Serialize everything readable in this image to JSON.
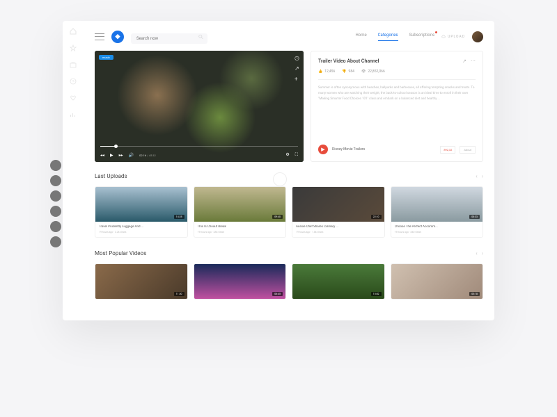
{
  "search": {
    "placeholder": "Search now"
  },
  "nav": {
    "home": "Home",
    "categories": "Categories",
    "subscriptions": "Subscriptions"
  },
  "upload": "UPLOAD",
  "player": {
    "tag": "music",
    "time": "02:16",
    "total": "/ 45:32"
  },
  "detail": {
    "title": "Trailer Video About Channel",
    "likes": "12,456",
    "dislikes": "984",
    "views": "22,852,066",
    "desc": "Summer is often synonymous with beaches, ballparks and barbecues, all offering tempting snacks and treats. To many women who are watching their weight, the back-to-school season is an ideal time to enroll in their own \"Making Smarter Food Choices 101\" class and embark on a balanced diet and healthy ...",
    "channel": "Disney Movie Trailers",
    "count": "892,32",
    "about": "About"
  },
  "sections": {
    "uploads": "Last Uploads",
    "popular": "Most Popular Videos"
  },
  "uploads": [
    {
      "title": "Travel Prudently Luggage And ...",
      "meta": "19 hours ago · 3.2k views",
      "dur": "14:25"
    },
    {
      "title": "This Is Choaut Break",
      "meta": "19 hours ago · 288 views",
      "dur": "09:40"
    },
    {
      "title": "Aussie Chef Shares Culinary ...",
      "meta": "19 hours ago · 1.8k views",
      "dur": "22:10"
    },
    {
      "title": "Choose The Perfect Accomm...",
      "meta": "19 hours ago · 840 views",
      "dur": "08:33"
    }
  ],
  "popular": [
    {
      "dur": "11:20"
    },
    {
      "dur": "06:45"
    },
    {
      "dur": "15:02"
    },
    {
      "dur": "05:18"
    }
  ]
}
